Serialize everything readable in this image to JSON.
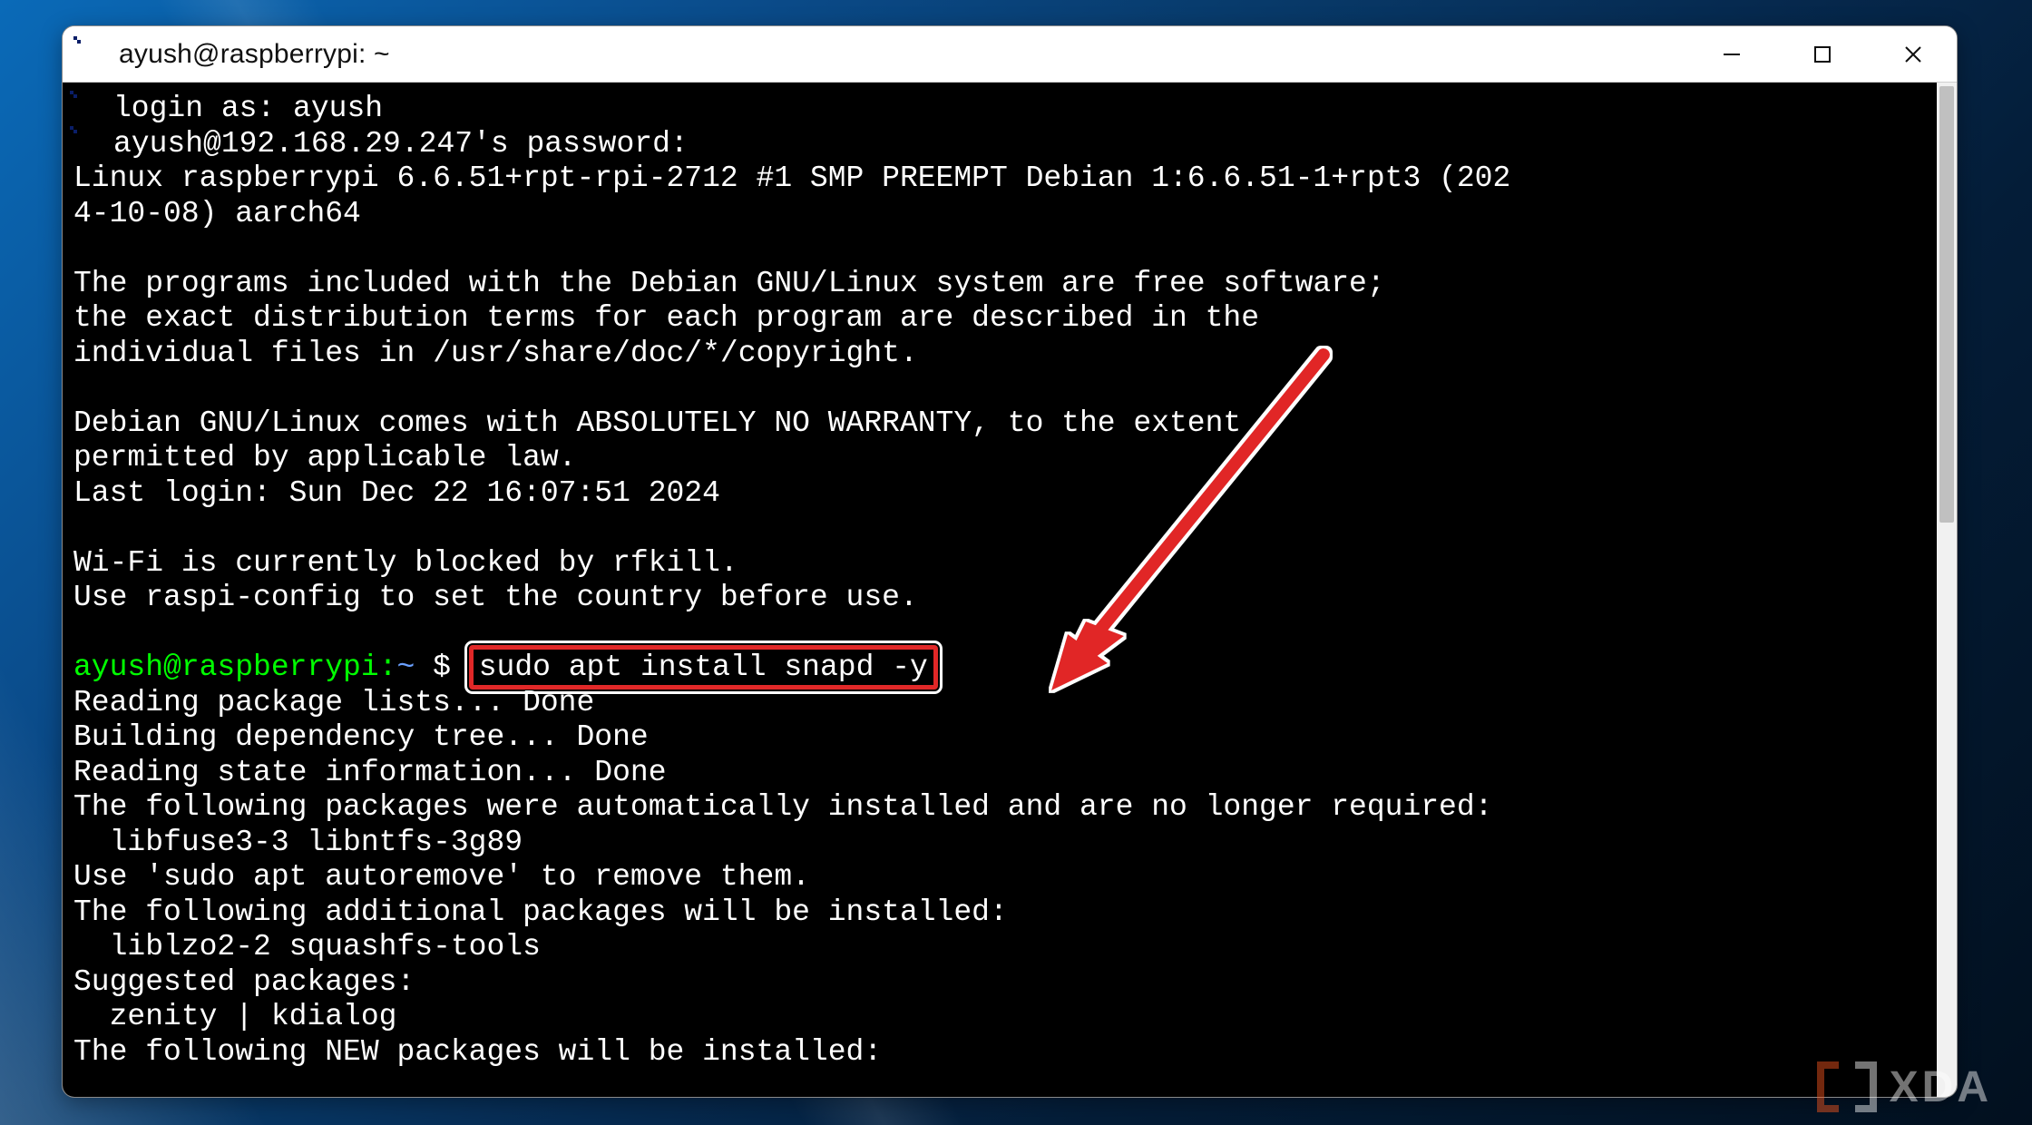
{
  "window": {
    "title": "ayush@raspberrypi: ~"
  },
  "prompt": {
    "user_host": "ayush@raspberrypi",
    "sep": ":",
    "cwd": "~",
    "symbol": "$",
    "command": "sudo apt install snapd -y"
  },
  "terminal": {
    "login_as": "login as: ayush",
    "password_prompt": "ayush@192.168.29.247's password:",
    "motd1": "Linux raspberrypi 6.6.51+rpt-rpi-2712 #1 SMP PREEMPT Debian 1:6.6.51-1+rpt3 (202",
    "motd1b": "4-10-08) aarch64",
    "blank": "",
    "motd2": "The programs included with the Debian GNU/Linux system are free software;",
    "motd3": "the exact distribution terms for each program are described in the",
    "motd4": "individual files in /usr/share/doc/*/copyright.",
    "motd5": "Debian GNU/Linux comes with ABSOLUTELY NO WARRANTY, to the extent",
    "motd6": "permitted by applicable law.",
    "last_login": "Last login: Sun Dec 22 16:07:51 2024",
    "wifi1": "Wi-Fi is currently blocked by rfkill.",
    "wifi2": "Use raspi-config to set the country before use.",
    "out1": "Reading package lists... Done",
    "out2": "Building dependency tree... Done",
    "out3": "Reading state information... Done",
    "out4": "The following packages were automatically installed and are no longer required:",
    "out5": "  libfuse3-3 libntfs-3g89",
    "out6": "Use 'sudo apt autoremove' to remove them.",
    "out7": "The following additional packages will be installed:",
    "out8": "  liblzo2-2 squashfs-tools",
    "out9": "Suggested packages:",
    "out10": "  zenity | kdialog",
    "out11": "The following NEW packages will be installed:"
  },
  "watermark": {
    "text": "XDA"
  },
  "colors": {
    "prompt_user": "#00ff00",
    "prompt_path": "#6aa0ff",
    "annotation": "#e12828"
  }
}
